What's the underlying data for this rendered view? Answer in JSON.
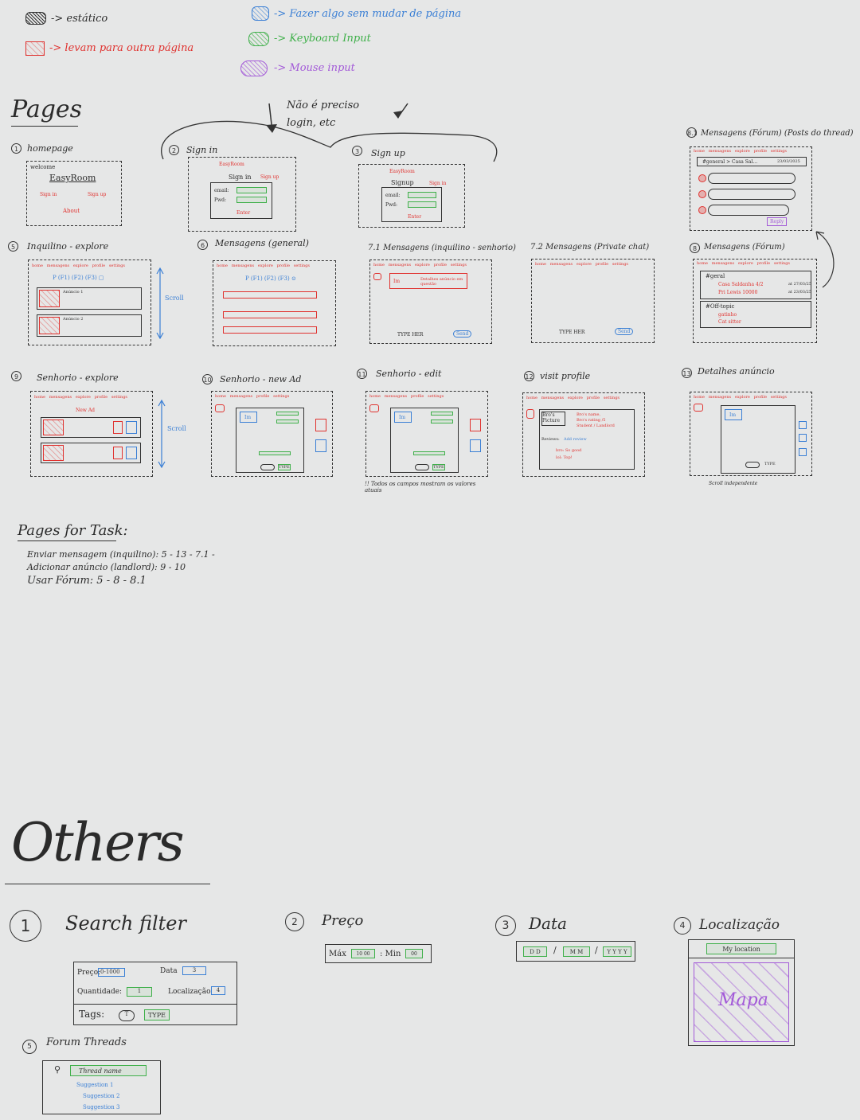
{
  "legend": {
    "static": "-> estático",
    "navigate": "-> levam para outra página",
    "same_page": "-> Fazer algo sem mudar de página",
    "keyboard": "-> Keyboard Input",
    "mouse": "-> Mouse input"
  },
  "pages_title": "Pages",
  "login_note": "Não é preciso login, etc",
  "app_name": "EasyRoom",
  "pages": {
    "p1": {
      "num": "1",
      "title": "homepage",
      "welcome": "welcome",
      "logo": "EasyRoom",
      "signin": "Sign in",
      "signup": "Sign up",
      "about": "About"
    },
    "p2": {
      "num": "2",
      "title": "Sign in",
      "logo": "EasyRoom",
      "heading": "Sign in",
      "alt": "Sign up",
      "email": "email:",
      "pwd": "Pwd:",
      "enter": "Enter"
    },
    "p3": {
      "num": "3",
      "title": "Sign up",
      "logo": "EasyRoom",
      "heading": "Signup",
      "alt": "Sign in",
      "email": "email:",
      "pwd": "Pwd:",
      "enter": "Enter"
    },
    "p5": {
      "num": "5",
      "title": "Inquilino - explore",
      "scroll": "Scroll"
    },
    "p6": {
      "num": "6",
      "title": "Mensagens (general)"
    },
    "p71": {
      "num": "7.1",
      "title": "Mensagens (inquilino - senhorio)",
      "details": "Detalhes anúncio em questão",
      "type": "TYPE HER",
      "send": "Send",
      "im": "Im"
    },
    "p72": {
      "num": "7.2",
      "title": "Mensagens (Private chat)",
      "type": "TYPE HER",
      "send": "Send"
    },
    "p8": {
      "num": "8",
      "title": "Mensagens (Fórum)",
      "tag1": "#geral",
      "item1": "Casa Saldanha 4/2",
      "item2": "Pri Lewis 10000",
      "date1": "at 27/03/25",
      "date2": "at 23/03/25",
      "tag2": "#Off-topic",
      "item3": "gatinho",
      "item4": "Cat sitter"
    },
    "p81": {
      "num": "8.1",
      "title": "Mensagens (Fórum) (Posts do thread)",
      "thread": "#general > Casa Sal...",
      "date": "23/03/2025",
      "reply": "Reply"
    },
    "p9": {
      "num": "9",
      "title": "Senhorio - explore",
      "scroll": "Scroll",
      "new_ad": "New Ad",
      "im": "Im"
    },
    "p10": {
      "num": "10",
      "title": "Senhorio - new Ad",
      "im": "Im",
      "type": "TYPE"
    },
    "p11": {
      "num": "11",
      "title": "Senhorio - edit",
      "note": "!! Todos os campos mostram os valores atuais",
      "im": "Im",
      "type": "TYPE"
    },
    "p12": {
      "num": "12",
      "title": "visit profile",
      "picture": "Bro's Picture",
      "name": "Bro's name,",
      "rating": "Bro's rating /5",
      "status": "Student / Landlord",
      "reviews": "Reviews:",
      "add_review": "Add review",
      "r1": "bro: So good",
      "r2": "lol: Top!"
    },
    "p13": {
      "num": "13",
      "title": "Detalhes anúncio",
      "im": "Im",
      "note": "Scroll independente",
      "type": "TYPE"
    }
  },
  "nav_items": [
    "home",
    "mensagens",
    "explore",
    "profile",
    "settings"
  ],
  "tasks": {
    "title": "Pages for Task:",
    "t1": "Enviar mensagem (inquilino): 5 - 13 - 7.1 -",
    "t2": "Adicionar anúncio (landlord): 9 - 10",
    "t3": "Usar Fórum: 5 - 8 - 8.1"
  },
  "others_title": "Others",
  "others": {
    "o1": {
      "num": "1",
      "title": "Search filter",
      "price": "Preço:",
      "price_val": "0-1000",
      "date": "Data",
      "date_val": "3",
      "qty": "Quantidade:",
      "qty_val": "1",
      "loc": "Localização",
      "loc_val": "4",
      "tags": "Tags:",
      "tags_icon": "T",
      "tags_val": "TYPE"
    },
    "o2": {
      "num": "2",
      "title": "Preço",
      "max": "Máx",
      "max_val": "10 00",
      "min": ": Min",
      "min_val": "00"
    },
    "o3": {
      "num": "3",
      "title": "Data",
      "dd": "D D",
      "mm": "M M",
      "yyyy": "Y Y Y Y",
      "sep": "/"
    },
    "o4": {
      "num": "4",
      "title": "Localização",
      "my_loc": "My location",
      "map": "Mapa"
    },
    "o5": {
      "num": "5",
      "title": "Forum Threads",
      "thread": "Thread name",
      "s1": "Suggestion 1",
      "s2": "Suggestion 2",
      "s3": "Suggestion 3"
    }
  },
  "colors": {
    "static": "#2b2b2b",
    "navigate": "#e0322f",
    "same_page": "#3a7fd5",
    "keyboard": "#3fb04a",
    "mouse": "#a35ad8",
    "paper": "#e6e7e7"
  }
}
